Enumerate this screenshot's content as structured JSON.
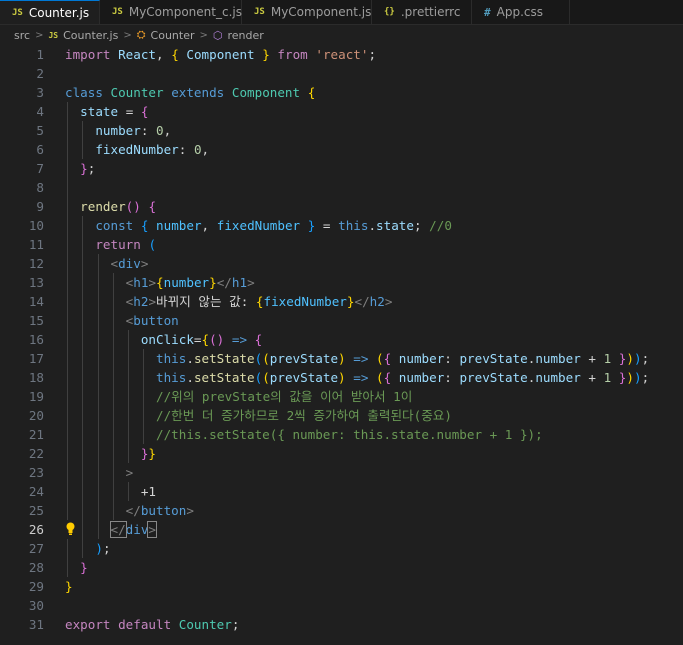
{
  "tabs": [
    {
      "label": "Counter.js",
      "icon": "JS",
      "active": true,
      "modified": true
    },
    {
      "label": "MyComponent_c.js",
      "icon": "JS"
    },
    {
      "label": "MyComponent.js",
      "icon": "JS"
    },
    {
      "label": ".prettierrc",
      "icon": "{}"
    },
    {
      "label": "App.css",
      "icon": "#"
    }
  ],
  "breadcrumb": {
    "folder": "src",
    "file": "Counter.js",
    "class": "Counter",
    "method": "render"
  },
  "line_numbers": [
    "1",
    "2",
    "3",
    "4",
    "5",
    "6",
    "7",
    "8",
    "9",
    "10",
    "11",
    "12",
    "13",
    "14",
    "15",
    "16",
    "17",
    "18",
    "19",
    "20",
    "21",
    "22",
    "23",
    "24",
    "25",
    "26",
    "27",
    "28",
    "29",
    "30",
    "31"
  ],
  "current_line": 26,
  "code": {
    "l1": [
      "import",
      "React",
      ",",
      "{",
      "Component",
      "}",
      "from",
      "'react'",
      ";"
    ],
    "l3": [
      "class",
      "Counter",
      "extends",
      "Component",
      "{"
    ],
    "l4": [
      "state",
      "=",
      "{"
    ],
    "l5": [
      "number",
      ":",
      "0",
      ","
    ],
    "l6": [
      "fixedNumber",
      ":",
      "0",
      ","
    ],
    "l7": [
      "}",
      ";"
    ],
    "l9": [
      "render",
      "()",
      "{"
    ],
    "l10": [
      "const",
      "{",
      "number",
      ",",
      "fixedNumber",
      "}",
      "=",
      "this",
      ".",
      "state",
      ";",
      "//0"
    ],
    "l11": [
      "return",
      "("
    ],
    "l12": [
      "<",
      "div",
      ">"
    ],
    "l13": [
      "<",
      "h1",
      ">",
      "{",
      "number",
      "}",
      "</",
      "h1",
      ">"
    ],
    "l14": [
      "<",
      "h2",
      ">",
      "바뀌지 않는 값: ",
      "{",
      "fixedNumber",
      "}",
      "</",
      "h2",
      ">"
    ],
    "l15": [
      "<",
      "button"
    ],
    "l16": [
      "onClick",
      "=",
      "{",
      "()",
      "=>",
      "{"
    ],
    "l17": [
      "this",
      ".",
      "setState",
      "(",
      "(",
      "prevState",
      ")",
      "=>",
      "(",
      "{",
      "number",
      ":",
      "prevState",
      ".",
      "number",
      "+",
      "1",
      "}",
      ")",
      ")",
      ";"
    ],
    "l18": [
      "this",
      ".",
      "setState",
      "(",
      "(",
      "prevState",
      ")",
      "=>",
      "(",
      "{",
      "number",
      ":",
      "prevState",
      ".",
      "number",
      "+",
      "1",
      "}",
      ")",
      ")",
      ";"
    ],
    "l19": "//위의 prevState의 값을 이어 받아서 1이",
    "l20": "//한번 더 증가하므로 2씩 증가하여 출력된다(중요)",
    "l21": "//this.setState({ number: this.state.number + 1 });",
    "l22": [
      "}",
      "}"
    ],
    "l23": [
      ">"
    ],
    "l24": "+1",
    "l25": [
      "</",
      "button",
      ">"
    ],
    "l26": [
      "</",
      "div",
      ">"
    ],
    "l27": [
      ")",
      ";"
    ],
    "l28": [
      "}"
    ],
    "l29": [
      "}"
    ],
    "l31": [
      "export",
      "default",
      "Counter",
      ";"
    ]
  },
  "colors": {
    "background": "#1f1f1f",
    "keyword": "#c586c0",
    "storage": "#569cd6",
    "class": "#4ec9b0",
    "variable": "#9cdcfe",
    "function": "#dcdcaa",
    "string": "#ce9178",
    "number": "#b5cea8",
    "comment": "#6a9955",
    "bracket1": "#ffd700",
    "bracket2": "#da70d6",
    "bracket3": "#179fff"
  }
}
